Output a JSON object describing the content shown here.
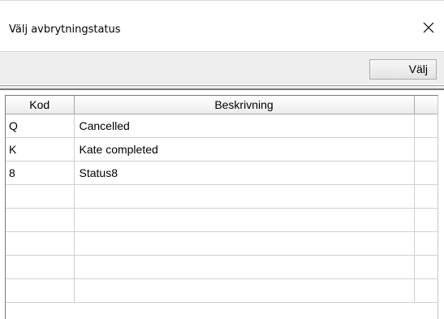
{
  "window": {
    "title": "Välj avbrytningstatus",
    "close_icon": "close-icon"
  },
  "toolbar": {
    "select_label": "Välj"
  },
  "table": {
    "columns": [
      "Kod",
      "Beskrivning",
      ""
    ],
    "rows": [
      {
        "kod": "Q",
        "beskrivning": "Cancelled"
      },
      {
        "kod": "K",
        "beskrivning": "Kate completed"
      },
      {
        "kod": "8",
        "beskrivning": "Status8"
      },
      {
        "kod": "",
        "beskrivning": ""
      },
      {
        "kod": "",
        "beskrivning": ""
      },
      {
        "kod": "",
        "beskrivning": ""
      },
      {
        "kod": "",
        "beskrivning": ""
      },
      {
        "kod": "",
        "beskrivning": ""
      }
    ]
  }
}
